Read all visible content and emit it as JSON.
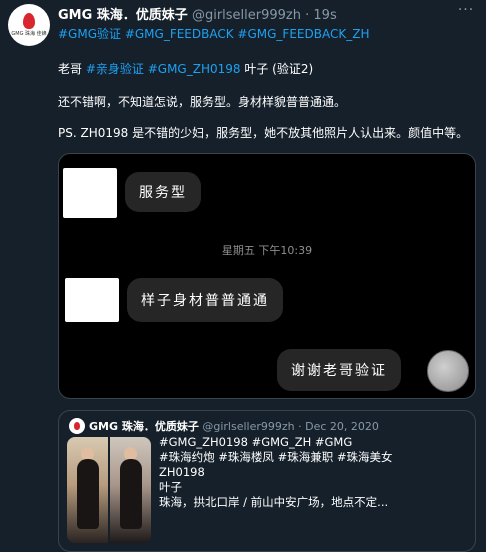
{
  "author": {
    "avatar_text": "GMG 珠海 佳蜂",
    "name": "GMG 珠海．优质妹子",
    "handle": "@girlseller999zh",
    "time": "· 19s"
  },
  "more_label": "···",
  "tweet": {
    "hashtags": "#GMG验证 #GMG_FEEDBACK #GMG_FEEDBACK_ZH",
    "line1_prefix": "老哥",
    "line1_links": "#亲身验证 #GMG_ZH0198",
    "line1_suffix": "叶子 (验证2)",
    "line2": "还不错啊，不知道怎说，服务型。身材样貌普普通通。",
    "line3": "PS. ZH0198 是不错的少妇，服务型，她不放其他照片人认出来。颜值中等。"
  },
  "chat": {
    "msg1": "服务型",
    "timestamp": "星期五 下午10:39",
    "msg2": "样子身材普普通通",
    "msg3": "谢谢老哥验证"
  },
  "quote": {
    "name": "GMG 珠海．优质妹子",
    "handle": "@girlseller999zh",
    "date": "· Dec 20, 2020",
    "line1": "#GMG_ZH0198 #GMG_ZH  #GMG",
    "line2": "#珠海约炮 #珠海楼凤 #珠海兼职  #珠海美女",
    "line3": "ZH0198",
    "line4": "叶子",
    "line5": "珠海，拱北口岸 / 前山中安广场，地点不定..."
  },
  "colors": {
    "background": "#15202b",
    "link": "#1da1f2",
    "muted": "#8899a6"
  },
  "icons": [
    "more-icon"
  ]
}
